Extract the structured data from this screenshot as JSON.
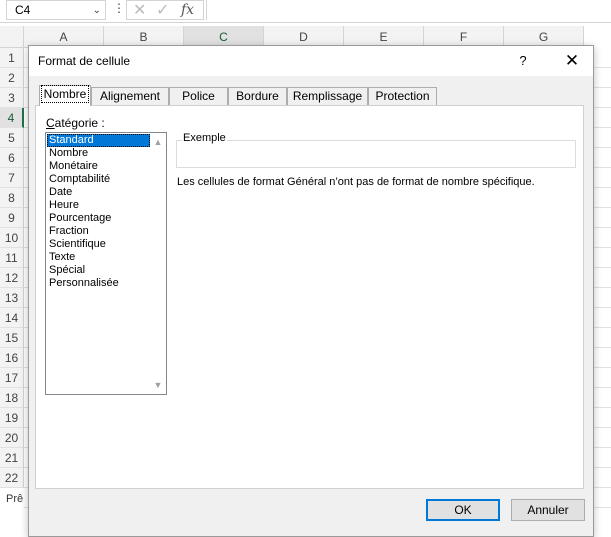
{
  "formula_bar": {
    "name_box": "C4",
    "more_icon": "more-vert-icon",
    "cancel_icon": "close-icon",
    "confirm_icon": "check-icon",
    "function_label": "fx",
    "formula_value": ""
  },
  "sheet": {
    "columns": [
      "A",
      "B",
      "C",
      "D",
      "E",
      "F",
      "G"
    ],
    "rows": [
      "1",
      "2",
      "3",
      "4",
      "5",
      "6",
      "7",
      "8",
      "9",
      "10",
      "11",
      "12",
      "13",
      "14",
      "15",
      "16",
      "17",
      "18",
      "19",
      "20",
      "21",
      "22"
    ],
    "active_column": "C",
    "active_row": "4",
    "status_fragment": "Prê"
  },
  "dialog": {
    "title": "Format de cellule",
    "help_label": "?",
    "close_icon": "close-icon",
    "tabs": [
      {
        "label": "Nombre",
        "active": true
      },
      {
        "label": "Alignement",
        "active": false
      },
      {
        "label": "Police",
        "active": false
      },
      {
        "label": "Bordure",
        "active": false
      },
      {
        "label": "Remplissage",
        "active": false
      },
      {
        "label": "Protection",
        "active": false
      }
    ],
    "category_label_prefix": "C",
    "category_label_rest": "atégorie :",
    "categories": [
      "Standard",
      "Nombre",
      "Monétaire",
      "Comptabilité",
      "Date",
      "Heure",
      "Pourcentage",
      "Fraction",
      "Scientifique",
      "Texte",
      "Spécial",
      "Personnalisée"
    ],
    "selected_category": "Standard",
    "sample_label": "Exemple",
    "sample_value": "",
    "description": "Les cellules de format Général n’ont pas de format de nombre spécifique.",
    "ok_label": "OK",
    "cancel_label": "Annuler"
  }
}
